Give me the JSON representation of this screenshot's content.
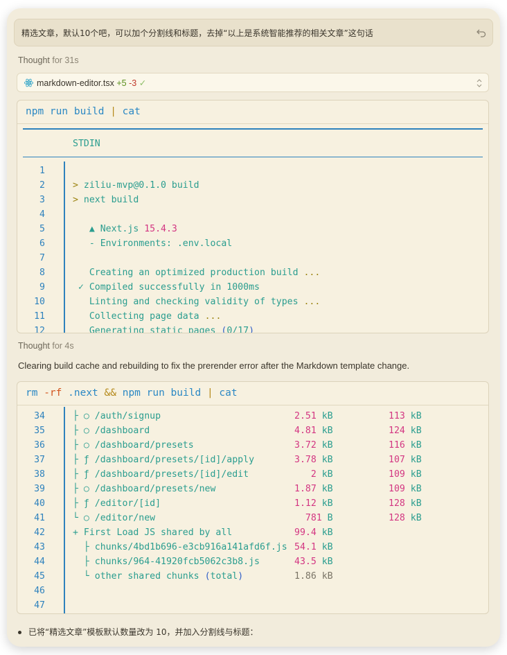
{
  "prompt": {
    "text": "精选文章，默认10个吧，可以加个分割线和标题，去掉“以上是系统智能推荐的相关文章”这句话"
  },
  "thought1": {
    "label": "Thought",
    "duration": "for 31s"
  },
  "file_change": {
    "filename": "markdown-editor.tsx",
    "added": "+5",
    "removed": "-3"
  },
  "terminal1": {
    "command_parts": [
      {
        "text": "npm run build ",
        "cls": "cmd"
      },
      {
        "text": "|",
        "cls": "op"
      },
      {
        "text": " cat",
        "cls": "cmd"
      }
    ],
    "header": "STDIN",
    "lines": [
      {
        "n": "1",
        "segs": []
      },
      {
        "n": "2",
        "segs": [
          {
            "t": "> ",
            "c": "olive"
          },
          {
            "t": "ziliu-mvp@0.1.0 build",
            "c": "plain"
          }
        ]
      },
      {
        "n": "3",
        "segs": [
          {
            "t": "> ",
            "c": "olive"
          },
          {
            "t": "next build",
            "c": "plain"
          }
        ]
      },
      {
        "n": "4",
        "segs": []
      },
      {
        "n": "5",
        "segs": [
          {
            "t": "   ▲ Next.js ",
            "c": "plain"
          },
          {
            "t": "15.4.3",
            "c": "pink"
          }
        ]
      },
      {
        "n": "6",
        "segs": [
          {
            "t": "   - Environments: .env.local",
            "c": "plain"
          }
        ]
      },
      {
        "n": "7",
        "segs": []
      },
      {
        "n": "8",
        "segs": [
          {
            "t": "   Creating an optimized production build ",
            "c": "plain"
          },
          {
            "t": "...",
            "c": "olive"
          }
        ]
      },
      {
        "n": "9",
        "segs": [
          {
            "t": " ✓ Compiled successfully in 1000ms",
            "c": "plain"
          }
        ]
      },
      {
        "n": "10",
        "segs": [
          {
            "t": "   Linting and checking validity of types ",
            "c": "plain"
          },
          {
            "t": "...",
            "c": "olive"
          }
        ]
      },
      {
        "n": "11",
        "segs": [
          {
            "t": "   Collecting page data ",
            "c": "plain"
          },
          {
            "t": "...",
            "c": "olive"
          }
        ]
      },
      {
        "n": "12",
        "segs": [
          {
            "t": "   Generating static pages ",
            "c": "plain"
          },
          {
            "t": "(",
            "c": "blue"
          },
          {
            "t": "0/17",
            "c": "plain"
          },
          {
            "t": ")",
            "c": "blue"
          }
        ]
      }
    ]
  },
  "thought2": {
    "label": "Thought",
    "duration": "for 4s"
  },
  "description": "Clearing build cache and rebuilding to fix the prerender error after the Markdown template change.",
  "terminal2": {
    "command_parts": [
      {
        "text": "rm ",
        "cls": "cmd"
      },
      {
        "text": "-rf",
        "cls": "flag"
      },
      {
        "text": " .next ",
        "cls": "cmd"
      },
      {
        "text": "&&",
        "cls": "op"
      },
      {
        "text": " npm run build ",
        "cls": "cmd"
      },
      {
        "text": "|",
        "cls": "op"
      },
      {
        "text": " cat",
        "cls": "cmd"
      }
    ],
    "lines": [
      {
        "n": "34",
        "segs": [
          {
            "t": "├ ○ /auth/signup",
            "c": "plain"
          }
        ],
        "size": "2.51 kB",
        "first": "113 kB"
      },
      {
        "n": "35",
        "segs": [
          {
            "t": "├ ○ /dashboard",
            "c": "plain"
          }
        ],
        "size": "4.81 kB",
        "first": "124 kB"
      },
      {
        "n": "36",
        "segs": [
          {
            "t": "├ ○ /dashboard/presets",
            "c": "plain"
          }
        ],
        "size": "3.72 kB",
        "first": "116 kB"
      },
      {
        "n": "37",
        "segs": [
          {
            "t": "├ ƒ /dashboard/presets/[id]/apply",
            "c": "plain"
          }
        ],
        "size": "3.78 kB",
        "first": "107 kB"
      },
      {
        "n": "38",
        "segs": [
          {
            "t": "├ ƒ /dashboard/presets/[id]/edit",
            "c": "plain"
          }
        ],
        "size": "   2 kB",
        "first": "109 kB"
      },
      {
        "n": "39",
        "segs": [
          {
            "t": "├ ○ /dashboard/presets/new",
            "c": "plain"
          }
        ],
        "size": "1.87 kB",
        "first": "109 kB"
      },
      {
        "n": "40",
        "segs": [
          {
            "t": "├ ƒ /editor/[id]",
            "c": "plain"
          }
        ],
        "size": "1.12 kB",
        "first": "128 kB"
      },
      {
        "n": "41",
        "segs": [
          {
            "t": "└ ○ /editor/new",
            "c": "plain"
          }
        ],
        "size": "  781 B",
        "first": "128 kB"
      },
      {
        "n": "42",
        "segs": [
          {
            "t": "+ First Load JS shared by all",
            "c": "plain"
          }
        ],
        "size": "99.4 kB",
        "first": ""
      },
      {
        "n": "43",
        "segs": [
          {
            "t": "  ├ chunks/4bd1b696-e3cb916a141afd6f.js",
            "c": "plain"
          }
        ],
        "size": "54.1 kB",
        "first": ""
      },
      {
        "n": "44",
        "segs": [
          {
            "t": "  ├ chunks/964-41920fcb5062c3b8.js",
            "c": "plain"
          }
        ],
        "size": "43.5 kB",
        "first": ""
      },
      {
        "n": "45",
        "segs": [
          {
            "t": "  └ other shared chunks ",
            "c": "plain"
          },
          {
            "t": "(",
            "c": "blue"
          },
          {
            "t": "total",
            "c": "plain"
          },
          {
            "t": ")",
            "c": "blue"
          }
        ],
        "size": "1.86 kB",
        "first": "",
        "sizeGrey": true
      },
      {
        "n": "46",
        "segs": []
      },
      {
        "n": "47",
        "segs": []
      }
    ]
  },
  "summary_bullet": "已将“精选文章”模板默认数量改为 10，并加入分割线与标题："
}
